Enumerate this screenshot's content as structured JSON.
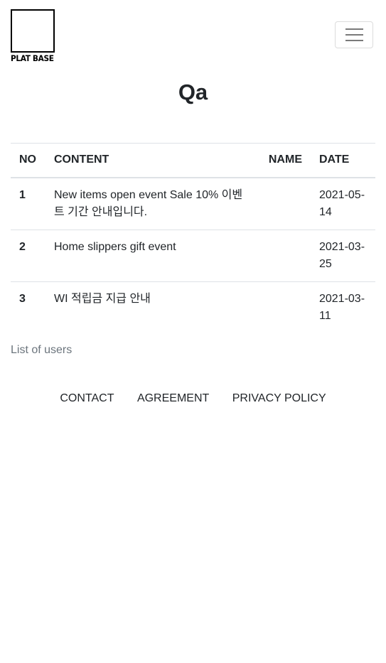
{
  "header": {
    "logo_text": "PLAT BASE"
  },
  "page": {
    "title": "Qa"
  },
  "table": {
    "columns": [
      "NO",
      "CONTENT",
      "NAME",
      "DATE"
    ],
    "rows": [
      {
        "no": "1",
        "content": "New items open event Sale 10% 이벤트 기간 안내입니다.",
        "name": "",
        "date": "2021-05-14"
      },
      {
        "no": "2",
        "content": "Home slippers gift event",
        "name": "",
        "date": "2021-03-25"
      },
      {
        "no": "3",
        "content": "WI 적립금 지급 안내",
        "name": "",
        "date": "2021-03-11"
      }
    ],
    "caption": "List of users"
  },
  "footer": {
    "links": [
      "CONTACT",
      "AGREEMENT",
      "PRIVACY POLICY"
    ]
  }
}
